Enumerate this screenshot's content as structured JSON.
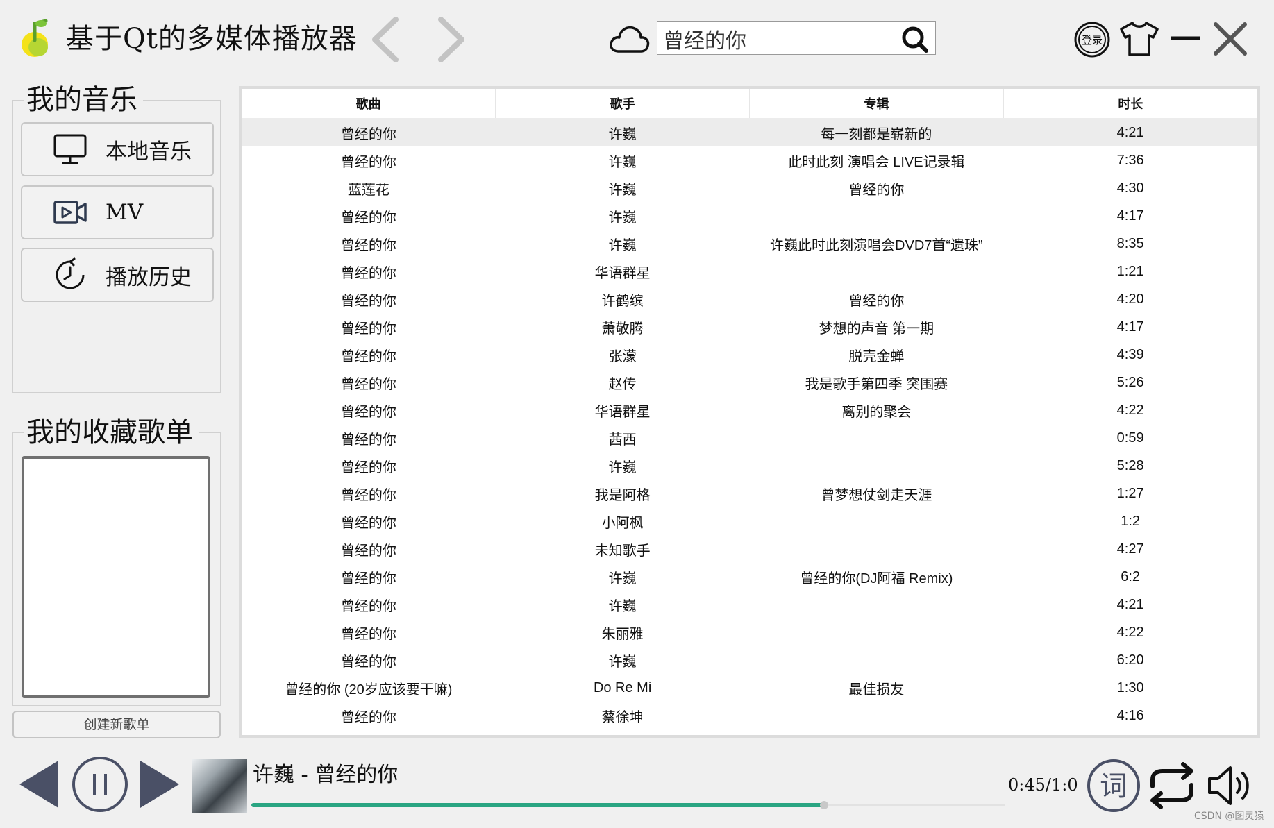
{
  "app": {
    "title": "基于Qt的多媒体播放器"
  },
  "search": {
    "value": "曾经的你"
  },
  "header": {
    "login_label": "登录",
    "icons": [
      "music-note-icon",
      "back-arrow-icon",
      "forward-arrow-icon",
      "cloud-icon",
      "search-icon",
      "login-icon",
      "skin-icon",
      "minimize-icon",
      "close-icon"
    ]
  },
  "sidebar": {
    "music_title": "我的音乐",
    "nav": [
      {
        "label": "本地音乐",
        "icon": "monitor-icon"
      },
      {
        "label": "MV",
        "icon": "video-icon"
      },
      {
        "label": "播放历史",
        "icon": "history-clock-icon"
      }
    ],
    "favorites_title": "我的收藏歌单",
    "create_playlist_label": "创建新歌单"
  },
  "table": {
    "columns": [
      "歌曲",
      "歌手",
      "专辑",
      "时长"
    ],
    "rows": [
      [
        "曾经的你",
        "许巍",
        "每一刻都是崭新的",
        "4:21"
      ],
      [
        "曾经的你",
        "许巍",
        "此时此刻 演唱会 LIVE记录辑",
        "7:36"
      ],
      [
        "蓝莲花",
        "许巍",
        "曾经的你",
        "4:30"
      ],
      [
        "曾经的你",
        "许巍",
        "",
        "4:17"
      ],
      [
        "曾经的你",
        "许巍",
        "许巍此时此刻演唱会DVD7首“遗珠”",
        "8:35"
      ],
      [
        "曾经的你",
        "华语群星",
        "",
        "1:21"
      ],
      [
        "曾经的你",
        "许鹤缤",
        "曾经的你",
        "4:20"
      ],
      [
        "曾经的你",
        "萧敬腾",
        "梦想的声音 第一期",
        "4:17"
      ],
      [
        "曾经的你",
        "张濛",
        "脱壳金蝉",
        "4:39"
      ],
      [
        "曾经的你",
        "赵传",
        "我是歌手第四季 突围赛",
        "5:26"
      ],
      [
        "曾经的你",
        "华语群星",
        "离别的聚会",
        "4:22"
      ],
      [
        "曾经的你",
        "茜西",
        "",
        "0:59"
      ],
      [
        "曾经的你",
        "许巍",
        "",
        "5:28"
      ],
      [
        "曾经的你",
        "我是阿格",
        "曾梦想仗剑走天涯",
        "1:27"
      ],
      [
        "曾经的你",
        "小阿枫",
        "",
        "1:2"
      ],
      [
        "曾经的你",
        "未知歌手",
        "",
        "4:27"
      ],
      [
        "曾经的你",
        "许巍",
        "曾经的你(DJ阿福 Remix)",
        "6:2"
      ],
      [
        "曾经的你",
        "许巍",
        "",
        "4:21"
      ],
      [
        "曾经的你",
        "朱丽雅",
        "",
        "4:22"
      ],
      [
        "曾经的你",
        "许巍",
        "",
        "6:20"
      ],
      [
        "曾经的你 (20岁应该要干嘛)",
        "Do Re Mi",
        "最佳损友",
        "1:30"
      ],
      [
        "曾经的你",
        "蔡徐坤",
        "",
        "4:16"
      ]
    ],
    "selected_row": 0
  },
  "player": {
    "now_playing": "许巍 - 曾经的你",
    "time": "0:45/1:0",
    "progress": 0.76,
    "lyrics_label": "词",
    "colors": {
      "progress": "#2aa582",
      "controls": "#4a5066"
    }
  },
  "watermark": "CSDN @图灵猿"
}
